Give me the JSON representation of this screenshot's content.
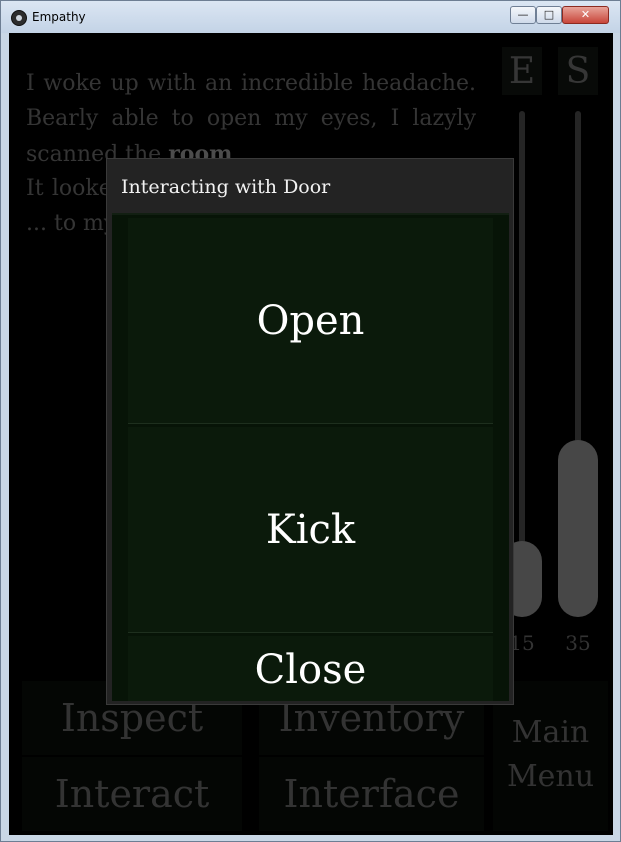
{
  "window": {
    "title": "Empathy",
    "min_label": "—",
    "max_label": "□",
    "close_label": "✕"
  },
  "story": {
    "line1": "I woke up with an incredible headache. Bearly able to open my eyes, I lazyly scanned the ",
    "room_word": "room",
    "line2": "It looked ... covered ... clue if ... was all ... to my ... from a ... the hea... sinister"
  },
  "stats": {
    "e": {
      "label": "E",
      "value": "15",
      "level": 0.15
    },
    "s": {
      "label": "S",
      "value": "35",
      "level": 0.35
    }
  },
  "bottom_menu": {
    "inspect": "Inspect",
    "inventory": "Inventory",
    "interact": "Interact",
    "interface": "Interface",
    "main_menu_line1": "Main",
    "main_menu_line2": "Menu"
  },
  "dialog": {
    "title": "Interacting with Door",
    "options": [
      "Open",
      "Kick",
      "Close"
    ]
  }
}
